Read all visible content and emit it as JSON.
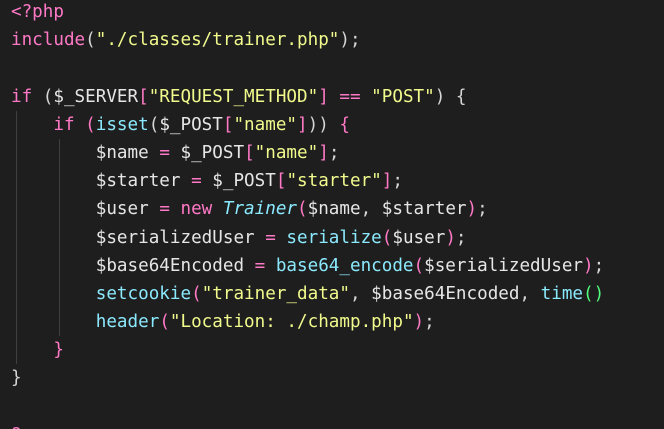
{
  "editor": {
    "theme": "dark",
    "colors": {
      "background": "#1e1e1e",
      "keyword": "#ff79c6",
      "string": "#f1fa8c",
      "function": "#8be9fd",
      "variable": "#e6e6e6"
    },
    "lines": [
      {
        "tokens": [
          {
            "t": "<?php",
            "c": "kw"
          }
        ]
      },
      {
        "tokens": [
          {
            "t": "include",
            "c": "kw"
          },
          {
            "t": "(",
            "c": "br"
          },
          {
            "t": "\"./classes/trainer.php\"",
            "c": "str"
          },
          {
            "t": ");",
            "c": "br"
          }
        ]
      },
      {
        "tokens": []
      },
      {
        "tokens": [
          {
            "t": "if",
            "c": "kw"
          },
          {
            "t": " (",
            "c": "br"
          },
          {
            "t": "$_SERVER",
            "c": "var"
          },
          {
            "t": "[",
            "c": "brk"
          },
          {
            "t": "\"REQUEST_METHOD\"",
            "c": "str"
          },
          {
            "t": "]",
            "c": "brk"
          },
          {
            "t": " ",
            "c": "br"
          },
          {
            "t": "==",
            "c": "op"
          },
          {
            "t": " ",
            "c": "br"
          },
          {
            "t": "\"POST\"",
            "c": "str"
          },
          {
            "t": ") {",
            "c": "br"
          }
        ]
      },
      {
        "indent": 1,
        "tokens": [
          {
            "t": "if",
            "c": "kw"
          },
          {
            "t": " (",
            "c": "brk"
          },
          {
            "t": "isset",
            "c": "fn"
          },
          {
            "t": "(",
            "c": "br"
          },
          {
            "t": "$_POST",
            "c": "var"
          },
          {
            "t": "[",
            "c": "brk"
          },
          {
            "t": "\"name\"",
            "c": "str"
          },
          {
            "t": "]",
            "c": "brk"
          },
          {
            "t": "))",
            "c": "br"
          },
          {
            "t": " {",
            "c": "brk"
          }
        ]
      },
      {
        "indent": 2,
        "tokens": [
          {
            "t": "$name",
            "c": "var"
          },
          {
            "t": " ",
            "c": "br"
          },
          {
            "t": "=",
            "c": "op"
          },
          {
            "t": " ",
            "c": "br"
          },
          {
            "t": "$_POST",
            "c": "var"
          },
          {
            "t": "[",
            "c": "brk"
          },
          {
            "t": "\"name\"",
            "c": "str"
          },
          {
            "t": "]",
            "c": "brk"
          },
          {
            "t": ";",
            "c": "br"
          }
        ]
      },
      {
        "indent": 2,
        "tokens": [
          {
            "t": "$starter",
            "c": "var"
          },
          {
            "t": " ",
            "c": "br"
          },
          {
            "t": "=",
            "c": "op"
          },
          {
            "t": " ",
            "c": "br"
          },
          {
            "t": "$_POST",
            "c": "var"
          },
          {
            "t": "[",
            "c": "brk"
          },
          {
            "t": "\"starter\"",
            "c": "str"
          },
          {
            "t": "]",
            "c": "brk"
          },
          {
            "t": ";",
            "c": "br"
          }
        ]
      },
      {
        "indent": 2,
        "tokens": [
          {
            "t": "$user",
            "c": "var"
          },
          {
            "t": " ",
            "c": "br"
          },
          {
            "t": "=",
            "c": "op"
          },
          {
            "t": " ",
            "c": "br"
          },
          {
            "t": "new",
            "c": "kw"
          },
          {
            "t": " ",
            "c": "br"
          },
          {
            "t": "Trainer",
            "c": "cls"
          },
          {
            "t": "(",
            "c": "brk"
          },
          {
            "t": "$name",
            "c": "var"
          },
          {
            "t": ", ",
            "c": "br"
          },
          {
            "t": "$starter",
            "c": "var"
          },
          {
            "t": ")",
            "c": "brk"
          },
          {
            "t": ";",
            "c": "br"
          }
        ]
      },
      {
        "indent": 2,
        "tokens": [
          {
            "t": "$serializedUser",
            "c": "var"
          },
          {
            "t": " ",
            "c": "br"
          },
          {
            "t": "=",
            "c": "op"
          },
          {
            "t": " ",
            "c": "br"
          },
          {
            "t": "serialize",
            "c": "fn"
          },
          {
            "t": "(",
            "c": "brk"
          },
          {
            "t": "$user",
            "c": "var"
          },
          {
            "t": ")",
            "c": "brk"
          },
          {
            "t": ";",
            "c": "br"
          }
        ]
      },
      {
        "indent": 2,
        "tokens": [
          {
            "t": "$base64Encoded",
            "c": "var"
          },
          {
            "t": " ",
            "c": "br"
          },
          {
            "t": "=",
            "c": "op"
          },
          {
            "t": " ",
            "c": "br"
          },
          {
            "t": "base64_encode",
            "c": "fn"
          },
          {
            "t": "(",
            "c": "brk"
          },
          {
            "t": "$serializedUser",
            "c": "var"
          },
          {
            "t": ")",
            "c": "brk"
          },
          {
            "t": ";",
            "c": "br"
          }
        ]
      },
      {
        "indent": 2,
        "tokens": [
          {
            "t": "setcookie",
            "c": "fn"
          },
          {
            "t": "(",
            "c": "brk"
          },
          {
            "t": "\"trainer_data\"",
            "c": "str"
          },
          {
            "t": ", ",
            "c": "br"
          },
          {
            "t": "$base64Encoded",
            "c": "var"
          },
          {
            "t": ", ",
            "c": "br"
          },
          {
            "t": "time",
            "c": "fn"
          },
          {
            "t": "()",
            "c": "sel"
          }
        ]
      },
      {
        "indent": 2,
        "tokens": [
          {
            "t": "header",
            "c": "fn"
          },
          {
            "t": "(",
            "c": "brk"
          },
          {
            "t": "\"Location: ./champ.php\"",
            "c": "str"
          },
          {
            "t": ")",
            "c": "brk"
          },
          {
            "t": ";",
            "c": "br"
          }
        ]
      },
      {
        "indent": 1,
        "tokens": [
          {
            "t": "}",
            "c": "brk"
          }
        ]
      },
      {
        "tokens": [
          {
            "t": "}",
            "c": "br"
          }
        ]
      },
      {
        "tokens": []
      },
      {
        "tokens": [
          {
            "t": "?>",
            "c": "kw"
          }
        ]
      }
    ]
  }
}
